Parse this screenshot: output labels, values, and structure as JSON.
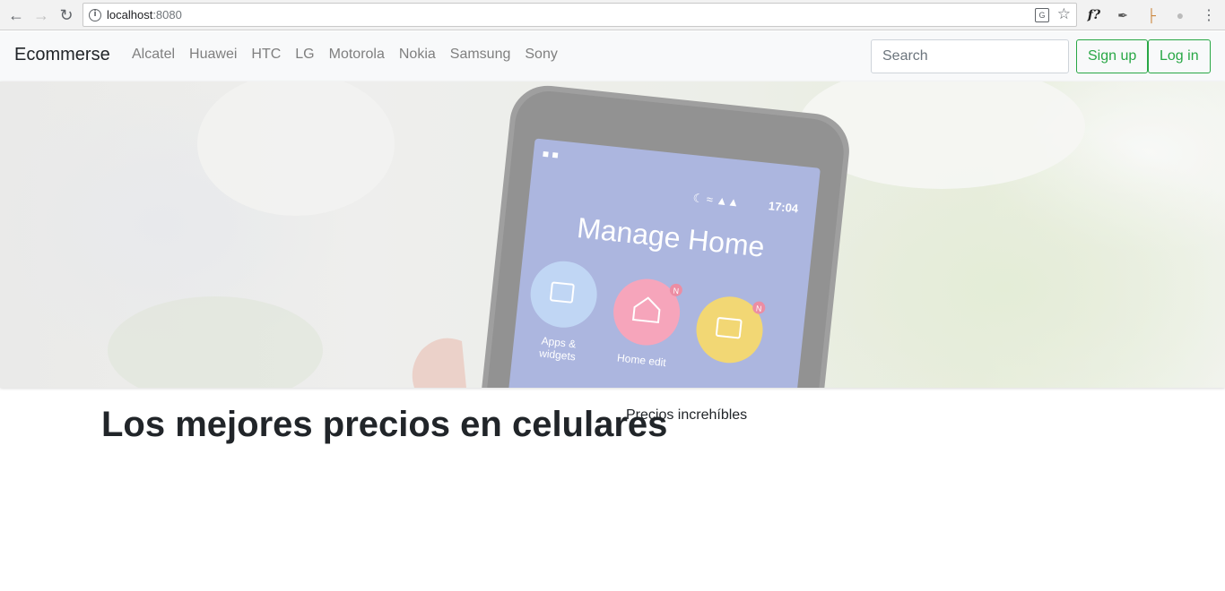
{
  "browser": {
    "url_host": "localhost",
    "url_port": ":8080"
  },
  "navbar": {
    "brand": "Ecommerse",
    "links": [
      "Alcatel",
      "Huawei",
      "HTC",
      "LG",
      "Motorola",
      "Nokia",
      "Samsung",
      "Sony"
    ],
    "search_placeholder": "Search",
    "signup_label": "Sign up",
    "login_label": "Log in",
    "accent_color": "#28a745"
  },
  "hero": {
    "phone_screen_title": "Manage Home",
    "phone_time": "17:04",
    "app_labels": [
      "Apps &",
      "widgets",
      "Home edit"
    ],
    "badge": "N"
  },
  "content": {
    "headline": "Los mejores precios en celulares",
    "subline": "Precios increhíbles"
  }
}
